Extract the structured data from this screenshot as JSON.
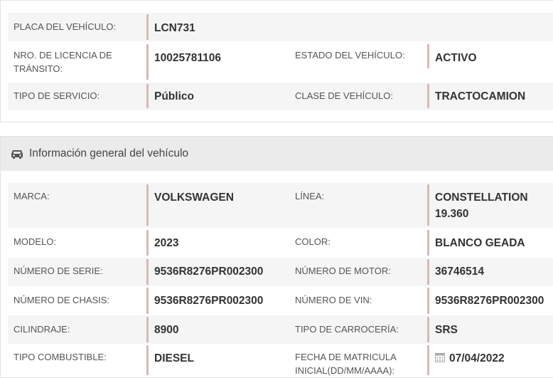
{
  "vehicle": {
    "plate_label": "PLACA DEL VEHÍCULO:",
    "plate_value": "LCN731",
    "license_label": "NRO. DE LICENCIA DE TRÁNSITO:",
    "license_value": "10025781106",
    "status_label": "ESTADO DEL VEHÍCULO:",
    "status_value": "ACTIVO",
    "service_label": "TIPO DE SERVICIO:",
    "service_value": "Público",
    "class_label": "CLASE DE VEHÍCULO:",
    "class_value": "TRACTOCAMION"
  },
  "general": {
    "title": "Información general del vehículo",
    "icon": "car-icon",
    "brand_label": "MARCA:",
    "brand_value": "VOLKSWAGEN",
    "line_label": "LÍNEA:",
    "line_value": "CONSTELLATION 19.360",
    "model_label": "MODELO:",
    "model_value": "2023",
    "color_label": "COLOR:",
    "color_value": "BLANCO GEADA",
    "serial_label": "NÚMERO DE SERIE:",
    "serial_value": "9536R8276PR002300",
    "engine_label": "NÚMERO DE MOTOR:",
    "engine_value": "36746514",
    "chassis_label": "NÚMERO DE CHASIS:",
    "chassis_value": "9536R8276PR002300",
    "vin_label": "NÚMERO DE VIN:",
    "vin_value": "9536R8276PR002300",
    "displacement_label": "CILINDRAJE:",
    "displacement_value": "8900",
    "body_label": "TIPO DE CARROCERÍA:",
    "body_value": "SRS",
    "fuel_label": "TIPO COMBUSTIBLE:",
    "fuel_value": "DIESEL",
    "registration_label": "FECHA DE MATRICULA INICIAL(DD/MM/AAAA):",
    "registration_value": "07/04/2022",
    "registration_icon": "calendar-icon"
  },
  "colors": {
    "row_alt": "#f5f5f5",
    "header_bg": "#ebebeb",
    "value_border": "#d9b8b8"
  }
}
